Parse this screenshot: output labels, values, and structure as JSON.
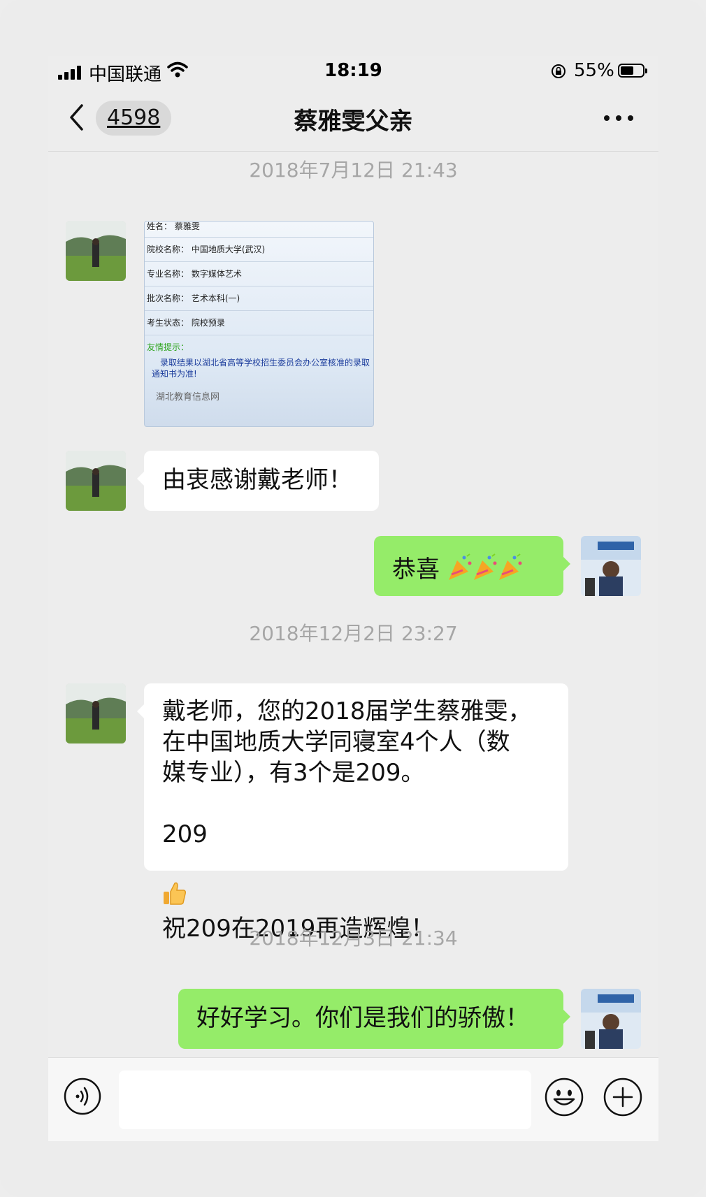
{
  "status_bar": {
    "carrier": "中国联通",
    "time": "18:19",
    "battery_percent": "55%",
    "battery_level": 0.55
  },
  "nav": {
    "unread_count": "4598",
    "title": "蔡雅雯父亲"
  },
  "timestamps": [
    "2018年7月12日 21:43",
    "2018年12月2日 23:27",
    "2018年12月3日 21:34"
  ],
  "admission_card": {
    "rows": [
      "姓名：  蔡雅雯",
      "院校名称：  中国地质大学(武汉)",
      "专业名称：  数字媒体艺术",
      "批次名称：  艺术本科(一)",
      "考生状态：  院校预录"
    ],
    "tip_title": "友情提示：",
    "tip_body": "录取结果以湖北省高等学校招生委员会办公室核准的录取通知书为准!",
    "tip_source": "湖北教育信息网"
  },
  "messages": {
    "thanks": "由衷感谢戴老师！",
    "congrats": "恭喜",
    "long_line1": "戴老师，您的2018届学生蔡雅雯，",
    "long_line2": "在中国地质大学同寝室4个人（数",
    "long_line3": "媒专业），有3个是209。",
    "long_line4": "209",
    "long_line5": "祝209在2019再造辉煌！",
    "study": "好好学习。你们是我们的骄傲！"
  },
  "colors": {
    "sent_bubble": "#95ec69",
    "received_bubble": "#ffffff",
    "background": "#ededed",
    "timestamp": "#a6a6a6"
  },
  "icons": [
    "signal-icon",
    "wifi-icon",
    "rotation-lock-icon",
    "battery-icon",
    "back-chevron-icon",
    "more-icon",
    "party-popper-icon",
    "thumbs-up-icon",
    "voice-icon",
    "emoji-icon",
    "plus-icon"
  ]
}
